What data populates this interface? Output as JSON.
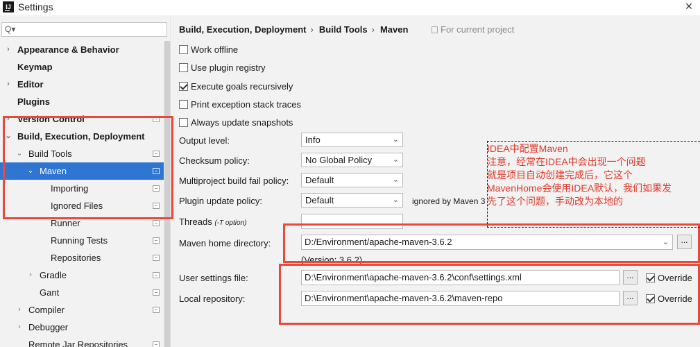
{
  "window": {
    "title": "Settings",
    "close_glyph": "×",
    "app_icon": "IJ"
  },
  "search": {
    "placeholder": "",
    "icon": "search-icon",
    "icon_glyph": "Q▾"
  },
  "tree": [
    {
      "label": "Appearance & Behavior",
      "bold": true,
      "arrow": "›",
      "indent": 0
    },
    {
      "label": "Keymap",
      "bold": true,
      "arrow": "",
      "indent": 0
    },
    {
      "label": "Editor",
      "bold": true,
      "arrow": "›",
      "indent": 0
    },
    {
      "label": "Plugins",
      "bold": true,
      "arrow": "",
      "indent": 0
    },
    {
      "label": "Version Control",
      "bold": true,
      "arrow": "›",
      "indent": 0,
      "project_icon": true
    },
    {
      "label": "Build, Execution, Deployment",
      "bold": true,
      "arrow": "⌄",
      "indent": 0
    },
    {
      "label": "Build Tools",
      "bold": false,
      "arrow": "⌄",
      "indent": 1,
      "project_icon": true
    },
    {
      "label": "Maven",
      "bold": false,
      "arrow": "⌄",
      "indent": 2,
      "project_icon": true,
      "selected": true
    },
    {
      "label": "Importing",
      "bold": false,
      "arrow": "",
      "indent": 3,
      "project_icon": true
    },
    {
      "label": "Ignored Files",
      "bold": false,
      "arrow": "",
      "indent": 3,
      "project_icon": true
    },
    {
      "label": "Runner",
      "bold": false,
      "arrow": "",
      "indent": 3,
      "project_icon": true
    },
    {
      "label": "Running Tests",
      "bold": false,
      "arrow": "",
      "indent": 3,
      "project_icon": true
    },
    {
      "label": "Repositories",
      "bold": false,
      "arrow": "",
      "indent": 3,
      "project_icon": true
    },
    {
      "label": "Gradle",
      "bold": false,
      "arrow": "›",
      "indent": 2,
      "project_icon": true
    },
    {
      "label": "Gant",
      "bold": false,
      "arrow": "",
      "indent": 2,
      "project_icon": true
    },
    {
      "label": "Compiler",
      "bold": false,
      "arrow": "›",
      "indent": 1,
      "project_icon": true
    },
    {
      "label": "Debugger",
      "bold": false,
      "arrow": "›",
      "indent": 1
    },
    {
      "label": "Remote Jar Repositories",
      "bold": false,
      "arrow": "",
      "indent": 1,
      "project_icon": true
    }
  ],
  "breadcrumb": {
    "items": [
      "Build, Execution, Deployment",
      "Build Tools",
      "Maven"
    ],
    "separator": "›",
    "for_project": "For current project"
  },
  "checkboxes": {
    "work_offline": {
      "label": "Work offline",
      "checked": false
    },
    "plugin_registry": {
      "label": "Use plugin registry",
      "checked": false
    },
    "execute_goals": {
      "label": "Execute goals recursively",
      "checked": true
    },
    "print_exception": {
      "label": "Print exception stack traces",
      "checked": false
    },
    "always_update": {
      "label": "Always update snapshots",
      "checked": false
    }
  },
  "form": {
    "output_level": {
      "label": "Output level:",
      "value": "Info"
    },
    "checksum_policy": {
      "label": "Checksum policy:",
      "value": "No Global Policy"
    },
    "multiproject_fail": {
      "label": "Multiproject build fail policy:",
      "value": "Default"
    },
    "plugin_update": {
      "label": "Plugin update policy:",
      "value": "Default",
      "note": "ignored by Maven 3"
    },
    "threads": {
      "label": "Threads",
      "hint": "(-T option)",
      "value": ""
    },
    "maven_home": {
      "label": "Maven home directory:",
      "value": "D:/Environment/apache-maven-3.6.2",
      "version": "(Version: 3.6.2)"
    },
    "user_settings": {
      "label": "User settings file:",
      "value": "D:\\Environment\\apache-maven-3.6.2\\conf\\settings.xml",
      "override_label": "Override",
      "override_checked": true
    },
    "local_repo": {
      "label": "Local repository:",
      "value": "D:\\Environment\\apache-maven-3.6.2\\maven-repo",
      "override_label": "Override",
      "override_checked": true
    },
    "browse_label": "..."
  },
  "annotation": {
    "lines": [
      "IDEA中配置Maven",
      "注意，经常在IDEA中会出现一个问题",
      "就是项目自动创建完成后，它这个",
      "MavenHome会使用IDEA默认，我们如果发",
      "先了这个问题，手动改为本地的"
    ],
    "color": "#e03a2b"
  },
  "colors": {
    "selection": "#2f75d2",
    "annotation_border": "#e8493b"
  }
}
